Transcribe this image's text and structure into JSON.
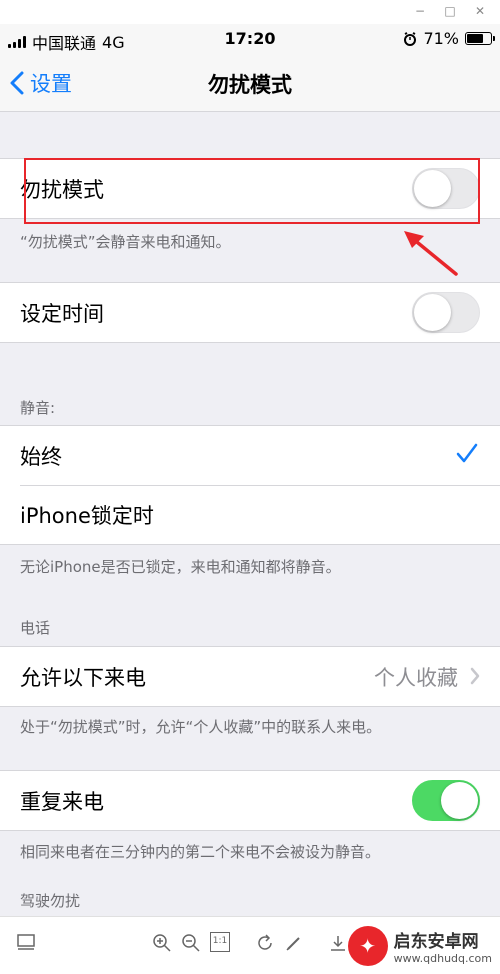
{
  "window": {
    "min": "−",
    "max": "□",
    "close": "✕"
  },
  "status_bar": {
    "carrier": "中国联通",
    "network": "4G",
    "time": "17:20",
    "battery": "71%",
    "battery_level": 0.71
  },
  "nav": {
    "back_label": "设置",
    "title": "勿扰模式"
  },
  "dnd": {
    "label": "勿扰模式",
    "enabled": false,
    "footer": "“勿扰模式”会静音来电和通知。"
  },
  "scheduled": {
    "label": "设定时间",
    "enabled": false
  },
  "silence": {
    "header": "静音:",
    "options": [
      "始终",
      "iPhone锁定时"
    ],
    "selected_index": 0,
    "footer": "无论iPhone是否已锁定，来电和通知都将静音。"
  },
  "phone": {
    "header": "电话",
    "allow_calls_label": "允许以下来电",
    "allow_calls_value": "个人收藏",
    "footer": "处于“勿扰模式”时，允许“个人收藏”中的联系人来电。",
    "repeated_label": "重复来电",
    "repeated_enabled": true,
    "repeated_footer": "相同来电者在三分钟内的第二个来电不会被设为静音。"
  },
  "driving": {
    "header": "驾驶勿扰"
  },
  "toolbar": {
    "page_btn": "1:1"
  },
  "watermark": {
    "name": "启东安卓网",
    "url": "www.qdhudq.com"
  },
  "colors": {
    "accent": "#147efb",
    "toggle_on": "#4cd964",
    "highlight": "#e8262b"
  }
}
